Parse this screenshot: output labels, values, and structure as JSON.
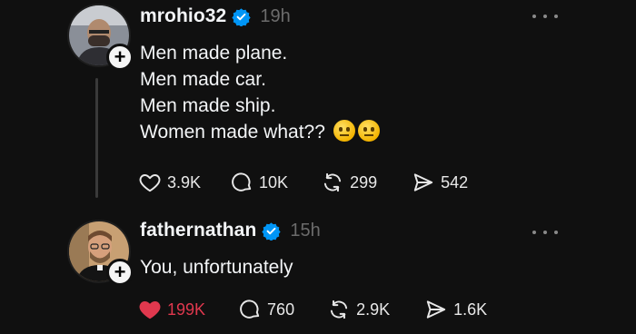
{
  "posts": [
    {
      "username": "mrohio32",
      "time": "19h",
      "lines": [
        "Men made plane.",
        "Men made car.",
        "Men made ship.",
        "Women made what??"
      ],
      "emojis": [
        "raised-eyebrow-emoji",
        "raised-eyebrow-emoji"
      ],
      "actions": {
        "likes": "3.9K",
        "replies": "10K",
        "reposts": "299",
        "shares": "542"
      },
      "liked": false
    },
    {
      "username": "fathernathan",
      "time": "15h",
      "lines": [
        "You, unfortunately"
      ],
      "actions": {
        "likes": "199K",
        "replies": "760",
        "reposts": "2.9K",
        "shares": "1.6K"
      },
      "liked": true
    }
  ],
  "colors": {
    "background": "#101010",
    "verified": "#0095f6",
    "liked": "#e0384e",
    "muted": "#6b6b6b"
  },
  "icons": {
    "follow": "plus-icon",
    "verified": "verified-badge-icon",
    "more": "more-icon",
    "like": "heart-icon",
    "reply": "comment-icon",
    "repost": "repost-icon",
    "share": "send-icon"
  }
}
